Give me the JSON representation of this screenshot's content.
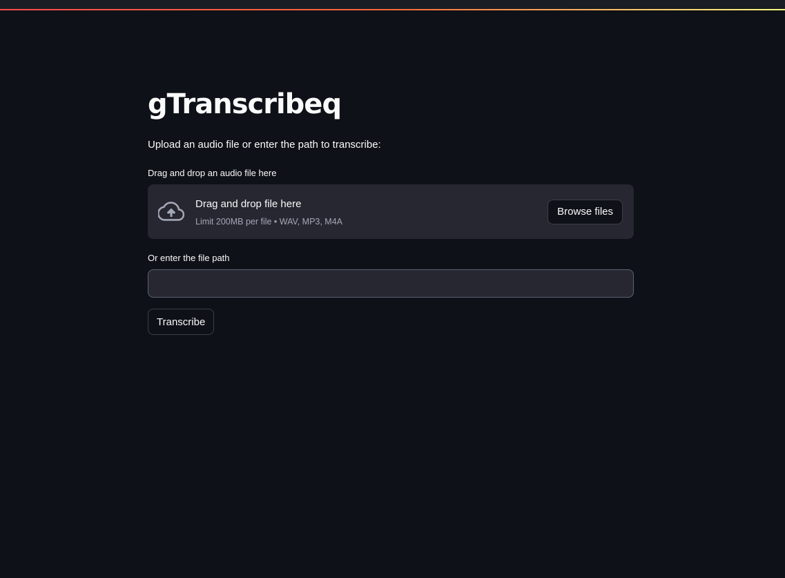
{
  "theme": {
    "background": "#0e1117",
    "panel": "#262730",
    "text": "#fafafa",
    "muted_text": "#a3a8b8",
    "accent_gradient": [
      "#ff4b4b",
      "#fffd80"
    ]
  },
  "app": {
    "title": "gTranscribeq",
    "intro": "Upload an audio file or enter the path to transcribe:"
  },
  "uploader": {
    "label": "Drag and drop an audio file here",
    "icon": "cloud-upload-icon",
    "dropzone_title": "Drag and drop file here",
    "dropzone_hint": "Limit 200MB per file • WAV, MP3, M4A",
    "browse_label": "Browse files"
  },
  "path_input": {
    "label": "Or enter the file path",
    "value": "",
    "placeholder": ""
  },
  "actions": {
    "transcribe_label": "Transcribe"
  }
}
